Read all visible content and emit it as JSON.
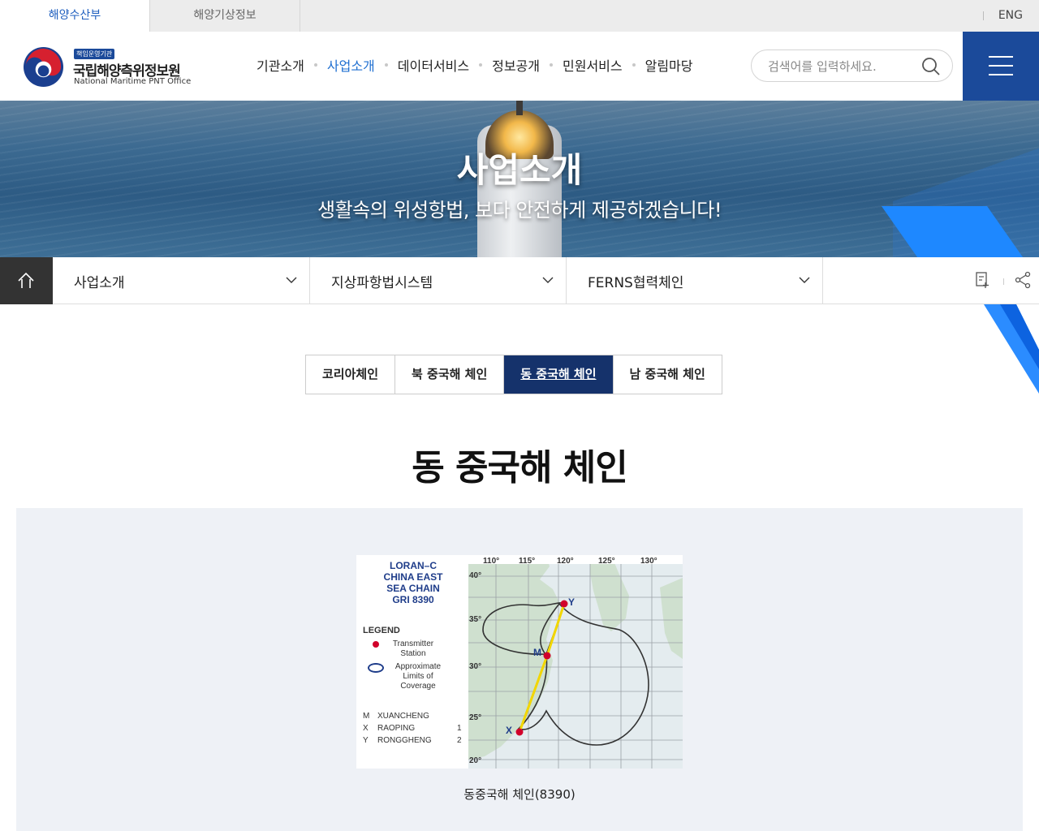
{
  "topbar": {
    "tabs": [
      "해양수산부",
      "해양기상정보"
    ],
    "lang": "ENG"
  },
  "header": {
    "logo": {
      "badge": "책임운영기관",
      "name_kor": "국립해양측위정보원",
      "name_eng": "National Maritime PNT Office"
    },
    "gnb": [
      "기관소개",
      "사업소개",
      "데이터서비스",
      "정보공개",
      "민원서비스",
      "알림마당"
    ],
    "active_gnb": "사업소개",
    "search_placeholder": "검색어를 입력하세요."
  },
  "visual": {
    "title": "사업소개",
    "subtitle": "생활속의 위성항법, 보다 안전하게 제공하겠습니다!"
  },
  "location": {
    "depth1": "사업소개",
    "depth2": "지상파항법시스템",
    "depth3": "FERNS협력체인"
  },
  "tabs": [
    "코리아체인",
    "북 중국해 체인",
    "동 중국해 체인",
    "남 중국해 체인"
  ],
  "active_tab": "동 중국해 체인",
  "page_title": "동 중국해 체인",
  "figure": {
    "chart_title": [
      "LORAN–C",
      "CHINA EAST",
      "SEA CHAIN",
      "GRI 8390"
    ],
    "legend_head": "LEGEND",
    "legend_station": [
      "Transmitter",
      "Station"
    ],
    "legend_coverage": [
      "Approximate",
      "Limits of",
      "Coverage"
    ],
    "stations": [
      {
        "code": "M",
        "name": "XUANCHENG",
        "num": ""
      },
      {
        "code": "X",
        "name": "RAOPING",
        "num": "1"
      },
      {
        "code": "Y",
        "name": "RONGGHENG",
        "num": "2"
      }
    ],
    "lon_labels": [
      "110°",
      "115°",
      "120°",
      "125°",
      "130°"
    ],
    "lat_labels": [
      "40°",
      "35°",
      "30°",
      "25°",
      "20°"
    ],
    "point_labels": {
      "Y": "Y",
      "M": "M",
      "X": "X"
    },
    "caption": "동중국해 체인(8390)"
  },
  "colors": {
    "brand": "#1b4a9a",
    "tab_active": "#15326b",
    "gnb_active": "#1f6fd1",
    "station": "#d1002b",
    "baseline": "#f2d600"
  }
}
